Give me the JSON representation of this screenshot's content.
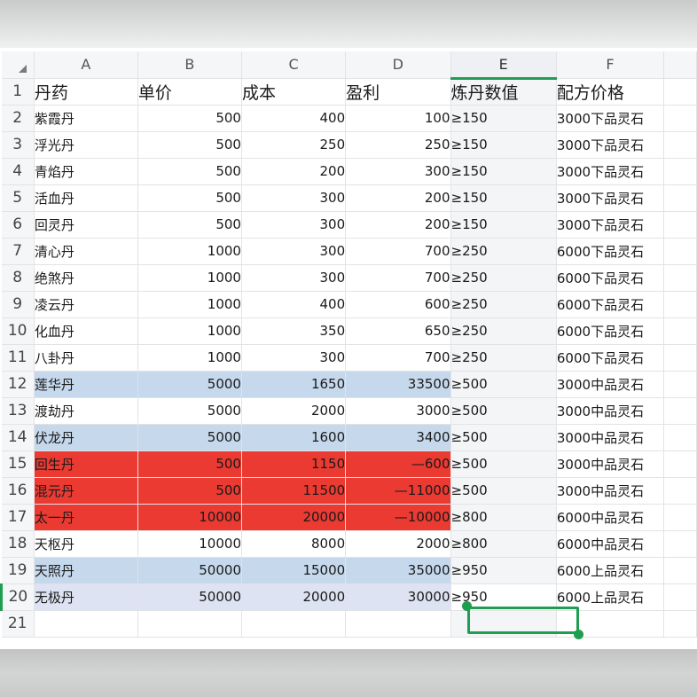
{
  "sheet": {
    "columns": [
      "A",
      "B",
      "C",
      "D",
      "E",
      "F"
    ],
    "active_column": "E",
    "active_row": 20,
    "header_row": [
      "丹药",
      "单价",
      "成本",
      "盈利",
      "炼丹数值",
      "配方价格"
    ],
    "rows": [
      {
        "n": "2",
        "hl": "",
        "cells": [
          "紫霞丹",
          "500",
          "400",
          "100",
          "≥150",
          "3000下品灵石"
        ]
      },
      {
        "n": "3",
        "hl": "",
        "cells": [
          "浮光丹",
          "500",
          "250",
          "250",
          "≥150",
          "3000下品灵石"
        ]
      },
      {
        "n": "4",
        "hl": "",
        "cells": [
          "青焰丹",
          "500",
          "200",
          "300",
          "≥150",
          "3000下品灵石"
        ]
      },
      {
        "n": "5",
        "hl": "",
        "cells": [
          "活血丹",
          "500",
          "300",
          "200",
          "≥150",
          "3000下品灵石"
        ]
      },
      {
        "n": "6",
        "hl": "",
        "cells": [
          "回灵丹",
          "500",
          "300",
          "200",
          "≥150",
          "3000下品灵石"
        ]
      },
      {
        "n": "7",
        "hl": "",
        "cells": [
          "清心丹",
          "1000",
          "300",
          "700",
          "≥250",
          "6000下品灵石"
        ]
      },
      {
        "n": "8",
        "hl": "",
        "cells": [
          "绝煞丹",
          "1000",
          "300",
          "700",
          "≥250",
          "6000下品灵石"
        ]
      },
      {
        "n": "9",
        "hl": "",
        "cells": [
          "凌云丹",
          "1000",
          "400",
          "600",
          "≥250",
          "6000下品灵石"
        ]
      },
      {
        "n": "10",
        "hl": "",
        "cells": [
          "化血丹",
          "1000",
          "350",
          "650",
          "≥250",
          "6000下品灵石"
        ]
      },
      {
        "n": "11",
        "hl": "",
        "cells": [
          "八卦丹",
          "1000",
          "300",
          "700",
          "≥250",
          "6000下品灵石"
        ]
      },
      {
        "n": "12",
        "hl": "blue",
        "cells": [
          "莲华丹",
          "5000",
          "1650",
          "33500",
          "≥500",
          "3000中品灵石"
        ]
      },
      {
        "n": "13",
        "hl": "",
        "cells": [
          "渡劫丹",
          "5000",
          "2000",
          "3000",
          "≥500",
          "3000中品灵石"
        ]
      },
      {
        "n": "14",
        "hl": "blue",
        "cells": [
          "伏龙丹",
          "5000",
          "1600",
          "3400",
          "≥500",
          "3000中品灵石"
        ]
      },
      {
        "n": "15",
        "hl": "red",
        "cells": [
          "回生丹",
          "500",
          "1150",
          "—600",
          "≥500",
          "3000中品灵石"
        ]
      },
      {
        "n": "16",
        "hl": "red",
        "cells": [
          "混元丹",
          "500",
          "11500",
          "—11000",
          "≥500",
          "3000中品灵石"
        ]
      },
      {
        "n": "17",
        "hl": "red",
        "cells": [
          "太一丹",
          "10000",
          "20000",
          "—10000",
          "≥800",
          "6000中品灵石"
        ]
      },
      {
        "n": "18",
        "hl": "",
        "cells": [
          "天枢丹",
          "10000",
          "8000",
          "2000",
          "≥800",
          "6000中品灵石"
        ]
      },
      {
        "n": "19",
        "hl": "blue",
        "cells": [
          "天照丹",
          "50000",
          "15000",
          "35000",
          "≥950",
          "6000上品灵石"
        ]
      },
      {
        "n": "20",
        "hl": "lav",
        "cells": [
          "无极丹",
          "50000",
          "20000",
          "30000",
          "≥950",
          "6000上品灵石"
        ]
      },
      {
        "n": "21",
        "hl": "",
        "cells": [
          "",
          "",
          "",
          "",
          "",
          ""
        ]
      }
    ],
    "colors": {
      "accent_green": "#1e9e50",
      "highlight_blue": "#c5d8ec",
      "highlight_red": "#ea3a32",
      "highlight_lavender": "#dde3f2"
    },
    "icons": {
      "corner": "select-all-triangle-icon",
      "selection_handles": "selection-handle-icon"
    }
  }
}
